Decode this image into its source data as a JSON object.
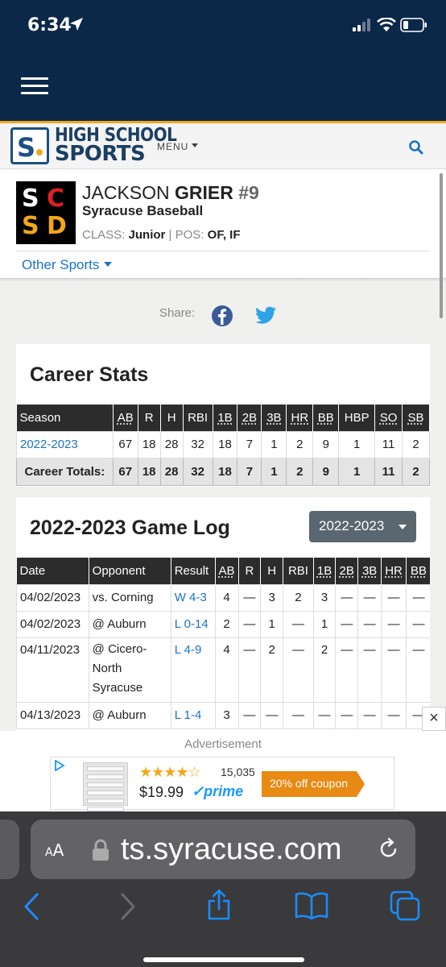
{
  "status": {
    "time": "6:34"
  },
  "site": {
    "brand_line1": "HIGH SCHOOL",
    "brand_line2": "SPORTS",
    "menu_label": "MENU"
  },
  "player": {
    "first_name": "JACKSON",
    "last_name": "GRIER",
    "number": "#9",
    "team": "Syracuse Baseball",
    "class_label": "CLASS:",
    "class_value": "Junior",
    "pos_label": "POS:",
    "pos_value": "OF, IF",
    "other_sports": "Other Sports",
    "logo_letters": [
      "S",
      "C",
      "S",
      "D"
    ]
  },
  "share": {
    "label": "Share:"
  },
  "career": {
    "title": "Career Stats",
    "headers": [
      "Season",
      "AB",
      "R",
      "H",
      "RBI",
      "1B",
      "2B",
      "3B",
      "HR",
      "BB",
      "HBP",
      "SO",
      "SB"
    ],
    "rows": [
      [
        "2022-2023",
        "67",
        "18",
        "28",
        "32",
        "18",
        "7",
        "1",
        "2",
        "9",
        "1",
        "11",
        "2"
      ]
    ],
    "totals": [
      "Career Totals:",
      "67",
      "18",
      "28",
      "32",
      "18",
      "7",
      "1",
      "2",
      "9",
      "1",
      "11",
      "2"
    ]
  },
  "gamelog": {
    "title": "2022-2023 Game Log",
    "season_select": "2022-2023",
    "headers": [
      "Date",
      "Opponent",
      "Result",
      "AB",
      "R",
      "H",
      "RBI",
      "1B",
      "2B",
      "3B",
      "HR",
      "BB"
    ],
    "rows": [
      {
        "date": "04/02/2023",
        "opponent": "vs. Corning",
        "result": "W 4-3",
        "ab": "4",
        "r": "—",
        "h": "3",
        "rbi": "2",
        "b1": "3",
        "b2": "—",
        "b3": "—",
        "hr": "—",
        "bb": "—"
      },
      {
        "date": "04/02/2023",
        "opponent": "@ Auburn",
        "result": "L 0-14",
        "ab": "2",
        "r": "—",
        "h": "1",
        "rbi": "—",
        "b1": "1",
        "b2": "—",
        "b3": "—",
        "hr": "—",
        "bb": "—"
      },
      {
        "date": "04/11/2023",
        "opponent": "@ Cicero-",
        "opponent_line2": "North",
        "opponent_line3": "Syracuse",
        "result": "L 4-9",
        "ab": "4",
        "r": "—",
        "h": "2",
        "rbi": "—",
        "b1": "2",
        "b2": "—",
        "b3": "—",
        "hr": "—",
        "bb": "—"
      },
      {
        "date": "04/13/2023",
        "opponent": "@ Auburn",
        "result": "L 1-4",
        "ab": "3",
        "r": "—",
        "h": "—",
        "rbi": "—",
        "b1": "—",
        "b2": "—",
        "b3": "—",
        "hr": "—",
        "bb": "—"
      }
    ]
  },
  "ad": {
    "label": "Advertisement",
    "close": "×",
    "stars": "★★★★☆",
    "rating_count": "15,035",
    "price": "$19.99",
    "prime": "✓prime",
    "coupon": "20% off coupon"
  },
  "browser": {
    "aa": "AA",
    "url": "ts.syracuse.com"
  },
  "colors": {
    "header_bg": "#0b2849",
    "accent": "#f2a71b",
    "link": "#1a73c9"
  }
}
